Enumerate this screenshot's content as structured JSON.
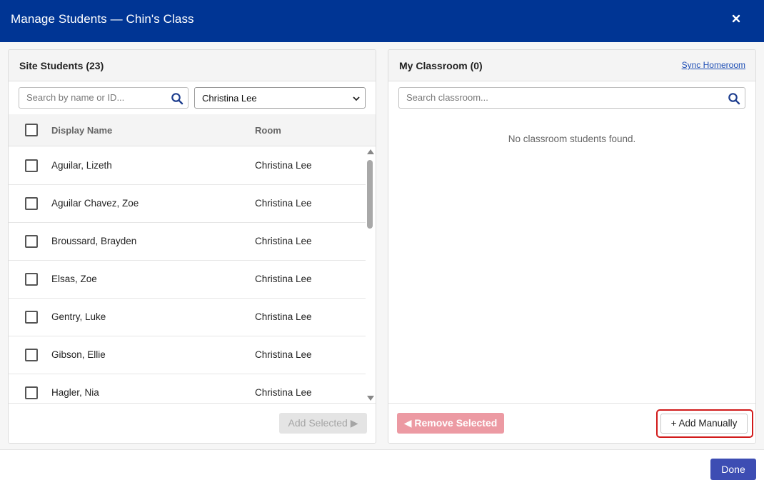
{
  "dialog": {
    "title": "Manage Students — Chin's Class",
    "close_icon": "close-icon"
  },
  "left": {
    "title": "Site Students (23)",
    "search_placeholder": "Search by name or ID...",
    "room_filter": "Christina Lee",
    "columns": {
      "name": "Display Name",
      "room": "Room"
    },
    "students": [
      {
        "name": "Aguilar, Lizeth",
        "room": "Christina Lee"
      },
      {
        "name": "Aguilar Chavez, Zoe",
        "room": "Christina Lee"
      },
      {
        "name": "Broussard, Brayden",
        "room": "Christina Lee"
      },
      {
        "name": "Elsas, Zoe",
        "room": "Christina Lee"
      },
      {
        "name": "Gentry, Luke",
        "room": "Christina Lee"
      },
      {
        "name": "Gibson, Ellie",
        "room": "Christina Lee"
      },
      {
        "name": "Hagler, Nia",
        "room": "Christina Lee"
      }
    ],
    "add_selected_label": "Add Selected ▶"
  },
  "right": {
    "title": "My Classroom (0)",
    "sync_label": "Sync Homeroom",
    "search_placeholder": "Search classroom...",
    "empty_message": "No classroom students found.",
    "remove_selected_label": "◀ Remove Selected",
    "add_manually_label": "+ Add Manually"
  },
  "footer": {
    "done_label": "Done"
  },
  "colors": {
    "header": "#003594",
    "done": "#3d4db3",
    "remove": "#ec9aa3",
    "highlight": "#d11a1a"
  }
}
